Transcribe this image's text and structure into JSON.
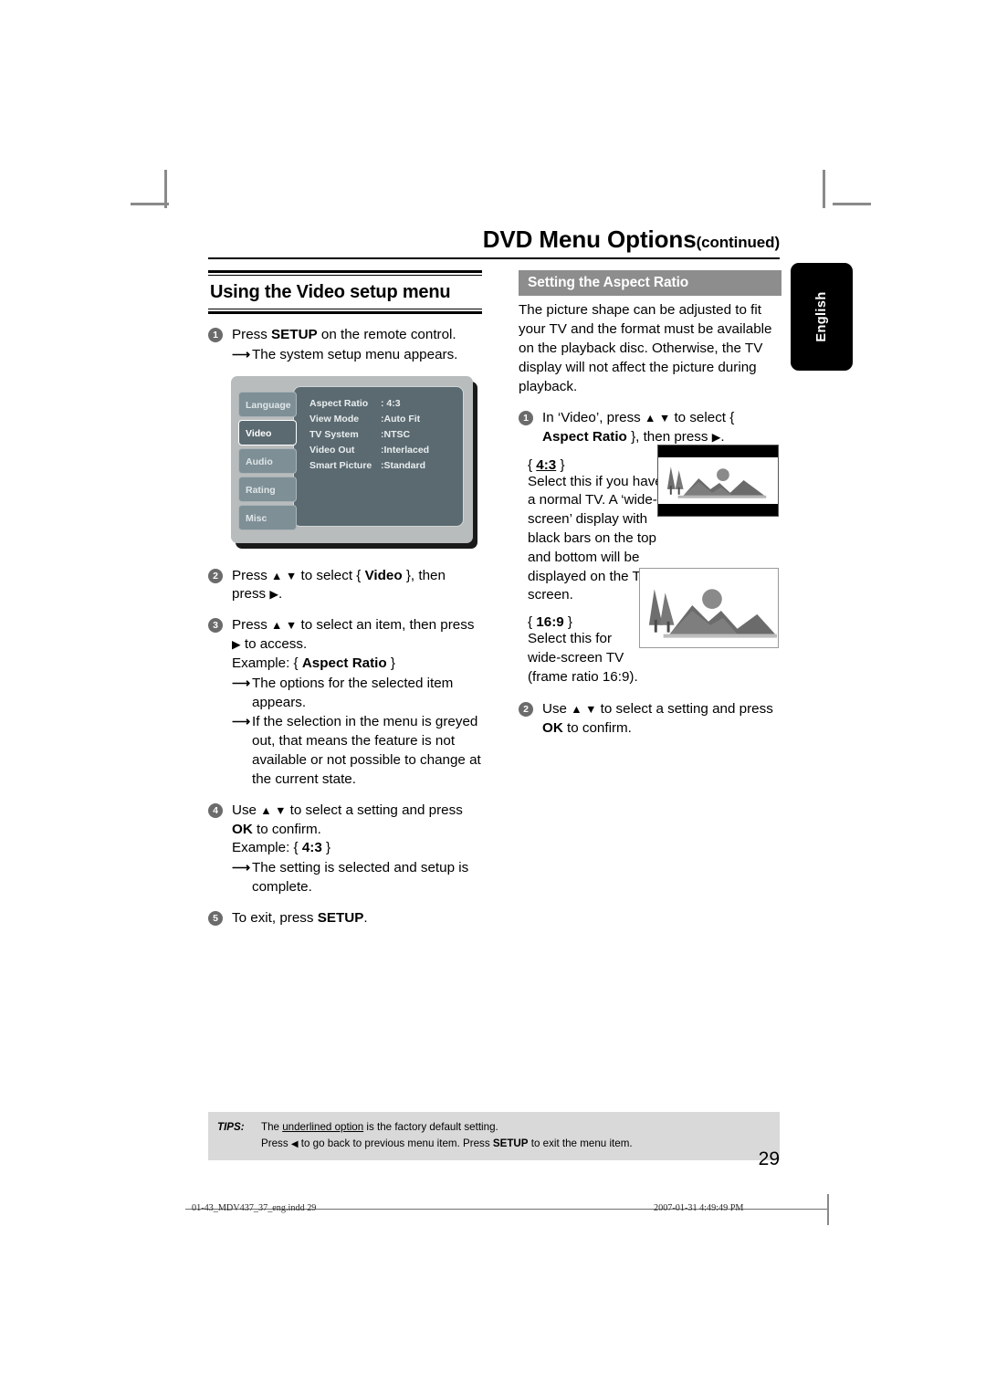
{
  "header": {
    "title": "DVD Menu Options",
    "title_suffix": "(continued)"
  },
  "side_tab": {
    "label": "English"
  },
  "left_column": {
    "heading": "Using the Video setup menu",
    "step1": {
      "number": "1",
      "text_before": "Press ",
      "bold": "SETUP",
      "text_after": " on the remote control.",
      "sub1": "The system setup menu appears."
    },
    "setup_menu": {
      "tabs": [
        {
          "label": "Language",
          "selected": false
        },
        {
          "label": "Video",
          "selected": true
        },
        {
          "label": "Audio",
          "selected": false
        },
        {
          "label": "Rating",
          "selected": false
        },
        {
          "label": "Misc",
          "selected": false
        }
      ],
      "rows": [
        {
          "label": "Aspect Ratio",
          "value": ": 4:3"
        },
        {
          "label": "View Mode",
          "value": ":Auto Fit"
        },
        {
          "label": "TV System",
          "value": ":NTSC"
        },
        {
          "label": "Video Out",
          "value": ":Interlaced"
        },
        {
          "label": "Smart Picture",
          "value": ":Standard"
        }
      ]
    },
    "step2": {
      "number": "2",
      "t1": "Press ",
      "arrows": "▲ ▼",
      "t2": " to select { ",
      "bold": "Video",
      "t3": " }, then press ",
      "right_arrow": "▶",
      "t4": "."
    },
    "step3": {
      "number": "3",
      "t1": "Press ",
      "arrows": "▲ ▼",
      "t2": " to select an item, then press ",
      "right_arrow": "▶",
      "t3": " to access.",
      "example_prefix": "Example: { ",
      "example_bold": "Aspect Ratio",
      "example_suffix": " }",
      "sub1": "The options for the selected item appears.",
      "sub2": "If the selection in the menu is greyed out, that means the feature is not available or not possible to change at the current state."
    },
    "step4": {
      "number": "4",
      "t1": "Use ",
      "arrows": "▲ ▼",
      "t2": " to select a setting and press ",
      "bold_ok": "OK",
      "t3": " to confirm.",
      "example_prefix": "Example: { ",
      "example_bold": "4:3",
      "example_suffix": " }",
      "sub1": "The setting is selected and setup is complete."
    },
    "step5": {
      "number": "5",
      "t1": "To exit, press ",
      "bold": "SETUP",
      "t2": "."
    }
  },
  "right_column": {
    "section_heading": "Setting the Aspect Ratio",
    "intro": "The picture shape can be adjusted to fit your TV and the format must be available on the playback disc. Otherwise, the TV display will not affect the picture during playback.",
    "step1": {
      "number": "1",
      "t1": "In ‘Video’, press ",
      "arrows": "▲ ▼",
      "t2": " to select { ",
      "bold": "Aspect Ratio",
      "t3": " }, then press ",
      "right_arrow": "▶",
      "t4": "."
    },
    "option_43": {
      "prefix": "{ ",
      "label": "4:3",
      "suffix": " }",
      "description": "Select this if you have a normal TV. A ‘wide-screen’ display with black bars on the top and bottom will be displayed on the TV screen."
    },
    "option_169": {
      "prefix": "{ ",
      "label": "16:9",
      "suffix": " }",
      "description": "Select this for wide-screen TV (frame ratio 16:9)."
    },
    "step2": {
      "number": "2",
      "t1": "Use ",
      "arrows": "▲ ▼",
      "t2": " to select a setting and press ",
      "bold_ok": "OK",
      "t3": " to confirm."
    }
  },
  "tips": {
    "label": "TIPS:",
    "line1_a": "The ",
    "line1_underlined": "underlined option",
    "line1_b": " is the factory default setting.",
    "line2_a": "Press ",
    "line2_arrow": "◀",
    "line2_b": " to go back to previous menu item. Press ",
    "line2_bold": "SETUP",
    "line2_c": " to exit the menu item."
  },
  "page_number": "29",
  "print_footer": {
    "file": "01-43_MDV437_37_eng.indd   29",
    "timestamp": "2007-01-31   4:49:49 PM"
  }
}
